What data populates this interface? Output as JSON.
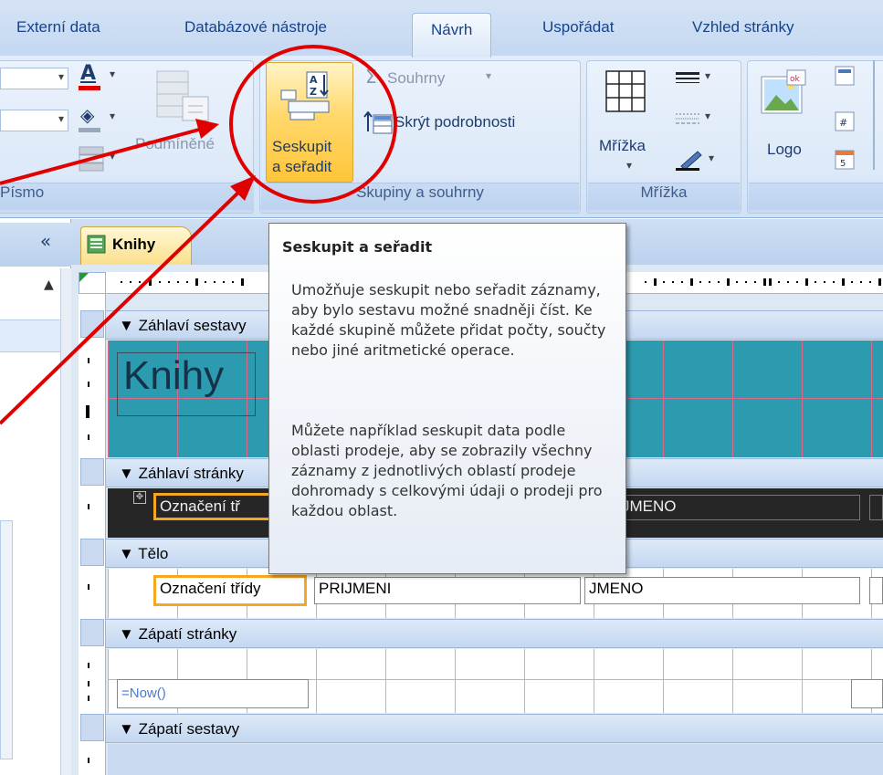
{
  "ribbon": {
    "tabs": [
      "Externí data",
      "Databázové nástroje",
      "Návrh",
      "Uspořádat",
      "Vzhled stránky"
    ],
    "active_tab": "Návrh",
    "font_group": {
      "label": "Písmo",
      "conditional_label": "Podmíněné"
    },
    "grouping_group": {
      "label": "Skupiny a souhrny",
      "group_sort_line1": "Seskupit",
      "group_sort_line2": "a seřadit",
      "totals_label": "Souhrny",
      "hide_details_label": "Skrýt podrobnosti"
    },
    "gridlines_group": {
      "label": "Mřížka",
      "gridlines_button": "Mřížka"
    },
    "controls_group": {
      "logo_label": "Logo"
    }
  },
  "document": {
    "tab_title": "Knihy",
    "collapse_glyph": "«"
  },
  "report": {
    "sections": {
      "report_header": "Záhlaví sestavy",
      "page_header": "Záhlaví stránky",
      "detail": "Tělo",
      "page_footer": "Zápatí stránky",
      "report_footer": "Zápatí sestavy"
    },
    "title_control": "Knihy",
    "page_header_controls": [
      "Označení tř",
      "JMENO"
    ],
    "detail_controls": [
      "Označení třídy",
      "PRIJMENI",
      "JMENO"
    ],
    "footer_control": "=Now()"
  },
  "tooltip": {
    "title": "Seskupit a seřadit",
    "paragraph1": "Umožňuje seskupit nebo seřadit záznamy, aby bylo sestavu možné snadněji číst. Ke každé skupině můžete přidat počty, součty nebo jiné aritmetické operace.",
    "paragraph2": "Můžete například seskupit data podle oblasti prodeje, aby se zobrazily všechny záznamy z jednotlivých oblastí prodeje dohromady s celkovými údaji o prodeji pro každou oblast."
  },
  "annotation": {
    "color": "#e10000"
  }
}
